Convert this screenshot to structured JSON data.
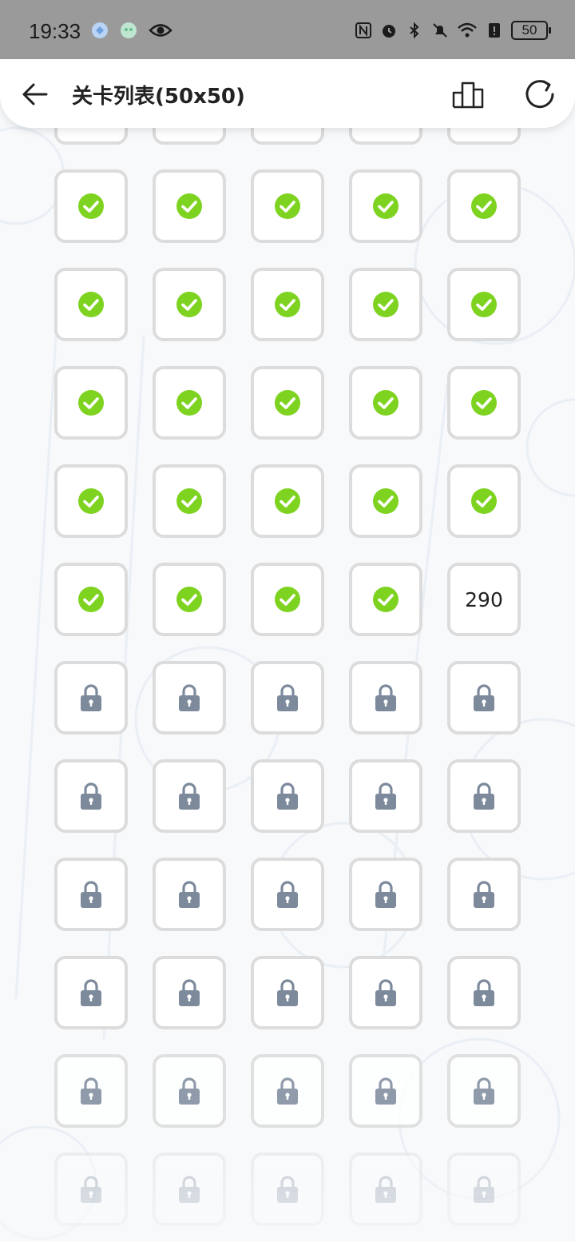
{
  "status_bar": {
    "time": "19:33",
    "battery": "50"
  },
  "header": {
    "title": "关卡列表(50x50)"
  },
  "icons": {
    "back": "arrow-left-icon",
    "rank": "podium-icon",
    "refresh": "refresh-icon",
    "done": "check-circle-icon",
    "locked": "lock-icon"
  },
  "colors": {
    "done_green": "#7ed321",
    "lock_gray": "#7d8a9c",
    "cell_border": "#dcdcdc"
  },
  "levels": {
    "current_level": "290",
    "rows": [
      [
        "done",
        "done",
        "done",
        "done",
        "done"
      ],
      [
        "done",
        "done",
        "done",
        "done",
        "done"
      ],
      [
        "done",
        "done",
        "done",
        "done",
        "done"
      ],
      [
        "done",
        "done",
        "done",
        "done",
        "done"
      ],
      [
        "done",
        "done",
        "done",
        "done",
        "current"
      ],
      [
        "locked",
        "locked",
        "locked",
        "locked",
        "locked"
      ],
      [
        "locked",
        "locked",
        "locked",
        "locked",
        "locked"
      ],
      [
        "locked",
        "locked",
        "locked",
        "locked",
        "locked"
      ],
      [
        "locked",
        "locked",
        "locked",
        "locked",
        "locked"
      ],
      [
        "locked",
        "locked",
        "locked",
        "locked",
        "locked"
      ],
      [
        "locked",
        "locked",
        "locked",
        "locked",
        "locked"
      ]
    ]
  }
}
